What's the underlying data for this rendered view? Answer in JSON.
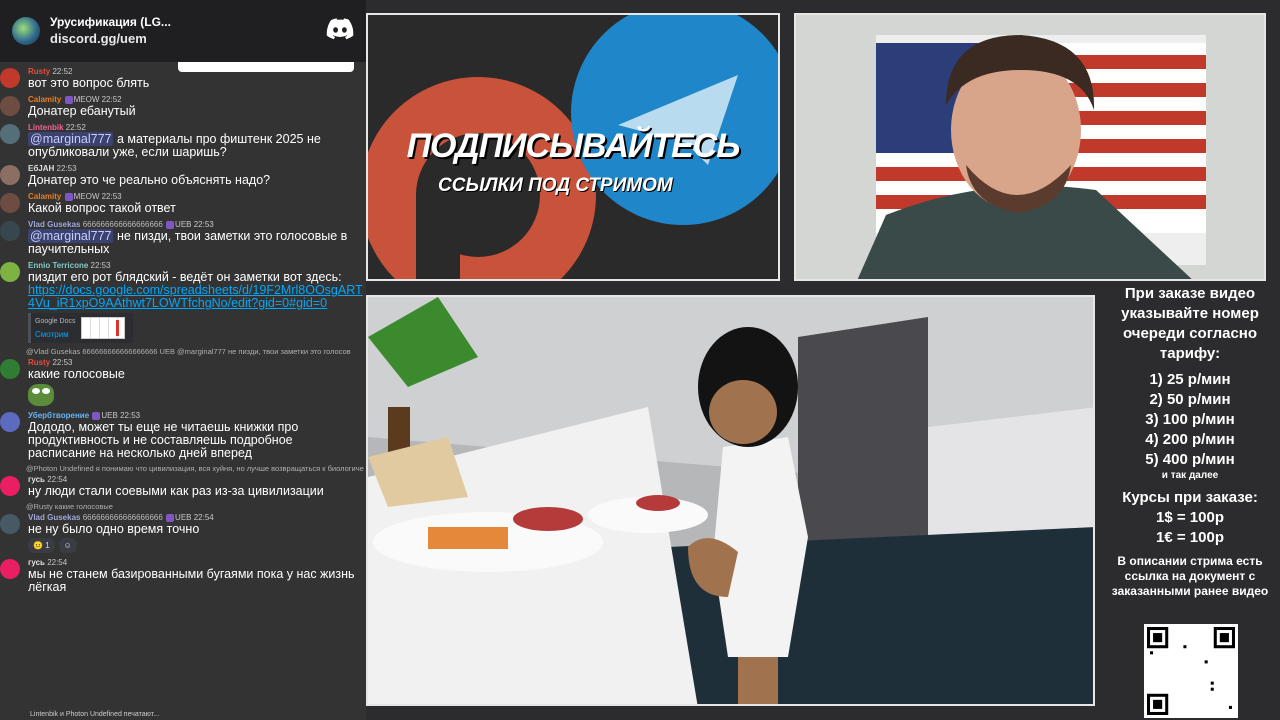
{
  "discord": {
    "server_name": "Урусификация (LG...",
    "invite": "discord.gg/uem",
    "logo_icon": "discord-logo-icon"
  },
  "chat": [
    {
      "user": "Rusty",
      "color": "#e74c3c",
      "time": "22:52",
      "text": "вот это вопрос блять"
    },
    {
      "user": "Calamity",
      "color": "#e67e22",
      "time": "22:52",
      "tag": "MEOW",
      "text": "Донатер ебанутый"
    },
    {
      "user": "Lintenbik",
      "color": "#f06292",
      "time": "22:52",
      "mention": "@marginal777",
      "text": "а материалы про фиштенк 2025 не опубликовали уже, если  шаришь?"
    },
    {
      "user": "ЕбЈАН",
      "color": "#e0e0e0",
      "time": "22:53",
      "text": "Донатер это че реально объяснять надо?"
    },
    {
      "user": "Calamity",
      "color": "#e67e22",
      "time": "22:53",
      "tag": "MEOW",
      "text": "Какой вопрос такой ответ"
    },
    {
      "user": "Vlad Gusekas",
      "color": "#9fa8da",
      "extra": "666666666666666666",
      "time": "22:53",
      "tag": "UEB",
      "mention": "@marginal777",
      "text": "не пизди, твои заметки это голосовые в паучительных"
    },
    {
      "user": "Ennio Terricone",
      "color": "#80cbc4",
      "time": "22:53",
      "text": "пиздит его рот блядский - ведёт он заметки вот здесь:",
      "link": "https://docs.google.com/spreadsheets/d/19F2Mrl8OOsgART4Vu_iR1xpO9AAthwt7LOWTfchgNo/edit?gid=0#gid=0",
      "embed_site": "Google Docs",
      "embed_title": "Смотрим"
    },
    {
      "reply": "@Vlad Gusekas 666666666666666666 UEB @marginal777 не пизди, твои заметки это голосов",
      "user": "Rusty",
      "color": "#e74c3c",
      "time": "22:53",
      "text": "какие голосовые"
    },
    {
      "user": "Убербтворение",
      "color": "#64b5f6",
      "time": "22:53",
      "tag": "UEB",
      "text": "Дододо, может ты еще не читаешь книжки про продуктивность и не составляешь подробное расписание на несколько дней вперед"
    },
    {
      "reply": "@Photon Undefined я понимаю что цивилизация, вся хуйня, но лучше возвращаться к биологиче",
      "user": "гусь",
      "color": "#e0e0e0",
      "time": "22:54",
      "text": "ну люди стали соевыми как раз из-за цивилизации"
    },
    {
      "reply": "@Rusty какие голосовые",
      "user": "Vlad Gusekas",
      "color": "#9fa8da",
      "extra": "666666666666666666",
      "time": "22:54",
      "tag": "UEB",
      "text": "не ну было одно время точно",
      "reaction": "1"
    },
    {
      "user": "гусь",
      "color": "#e0e0e0",
      "time": "22:54",
      "text": "мы не станем базированными бугаями пока у нас жизнь лёгкая"
    }
  ],
  "typing": "Lintenbik и Photon Undefined печатают...",
  "promo": {
    "title": "ПОДПИСЫВАЙТЕСЬ",
    "subtitle": "ССЫЛКИ ПОД СТРИМОМ"
  },
  "info": {
    "header": "При заказе видео указывайте номер очереди согласно тарифу:",
    "rates": [
      "1) 25 р/мин",
      "2) 50 р/мин",
      "3) 100 р/мин",
      "4) 200 р/мин",
      "5) 400 р/мин"
    ],
    "more": "и так далее",
    "courses_title": "Курсы при заказе:",
    "courses": [
      "1$ = 100р",
      "1€ = 100р"
    ],
    "description": "В описании стрима есть ссылка на документ с заказанными ранее видео"
  }
}
